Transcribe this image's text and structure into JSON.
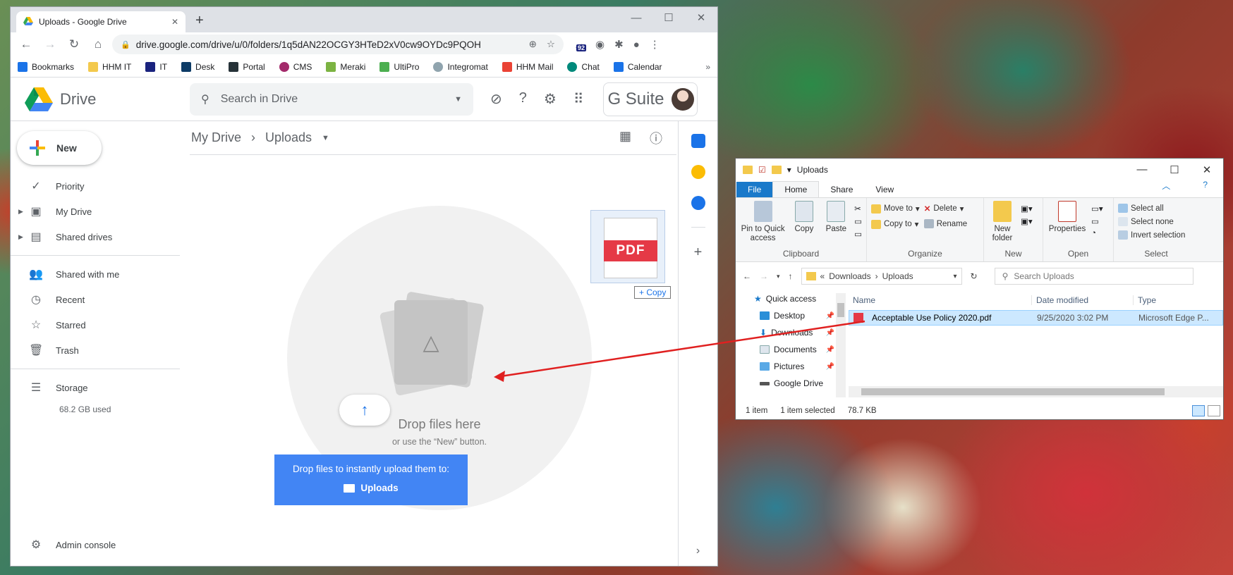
{
  "browser": {
    "tab_title": "Uploads - Google Drive",
    "url": "drive.google.com/drive/u/0/folders/1q5dAN22OCGY3HTeD2xV0cw9OYDc9PQOH",
    "extension_badge": "92",
    "bookmarks": [
      "Bookmarks",
      "HHM IT",
      "IT",
      "Desk",
      "Portal",
      "CMS",
      "Meraki",
      "UltiPro",
      "Integromat",
      "HHM Mail",
      "Chat",
      "Calendar"
    ]
  },
  "drive": {
    "logo_text": "Drive",
    "search_placeholder": "Search in Drive",
    "gsuite_label": "G Suite",
    "new_label": "New",
    "nav": [
      {
        "label": "Priority",
        "icon": "priority-icon"
      },
      {
        "label": "My Drive",
        "icon": "my-drive-icon"
      },
      {
        "label": "Shared drives",
        "icon": "shared-drives-icon"
      },
      {
        "label": "Shared with me",
        "icon": "shared-with-me-icon"
      },
      {
        "label": "Recent",
        "icon": "recent-icon"
      },
      {
        "label": "Starred",
        "icon": "star-icon"
      },
      {
        "label": "Trash",
        "icon": "trash-icon"
      }
    ],
    "storage_label": "Storage",
    "storage_used": "68.2 GB used",
    "admin_label": "Admin console",
    "breadcrumb_root": "My Drive",
    "breadcrumb_current": "Uploads",
    "drop_title": "Drop files here",
    "drop_subtitle": "or use the “New” button.",
    "upload_prompt": "Drop files to instantly upload them to:",
    "upload_folder": "Uploads",
    "drag_file_label": "PDF",
    "copy_tooltip": "+ Copy"
  },
  "explorer": {
    "title": "Uploads",
    "ribbon_tabs": [
      "File",
      "Home",
      "Share",
      "View"
    ],
    "clipboard": {
      "pin": "Pin to Quick access",
      "copy": "Copy",
      "paste": "Paste",
      "group": "Clipboard"
    },
    "organize": {
      "move_to": "Move to",
      "copy_to": "Copy to",
      "delete": "Delete",
      "rename": "Rename",
      "group": "Organize"
    },
    "new_group": {
      "new_folder": "New folder",
      "group": "New"
    },
    "open_group": {
      "properties": "Properties",
      "group": "Open"
    },
    "select_group": {
      "select_all": "Select all",
      "select_none": "Select none",
      "invert": "Invert selection",
      "group": "Select"
    },
    "path": [
      "Downloads",
      "Uploads"
    ],
    "path_prefix": "«",
    "search_placeholder": "Search Uploads",
    "tree": [
      "Quick access",
      "Desktop",
      "Downloads",
      "Documents",
      "Pictures",
      "Google Drive"
    ],
    "columns": [
      "Name",
      "Date modified",
      "Type"
    ],
    "file": {
      "name": "Acceptable Use Policy 2020.pdf",
      "modified": "9/25/2020 3:02 PM",
      "type": "Microsoft Edge P..."
    },
    "status_items": "1 item",
    "status_selected": "1 item selected",
    "status_size": "78.7 KB"
  },
  "colors": {
    "drive_blue": "#4285f4",
    "selection": "#cce8ff",
    "arrow": "#e02020"
  }
}
